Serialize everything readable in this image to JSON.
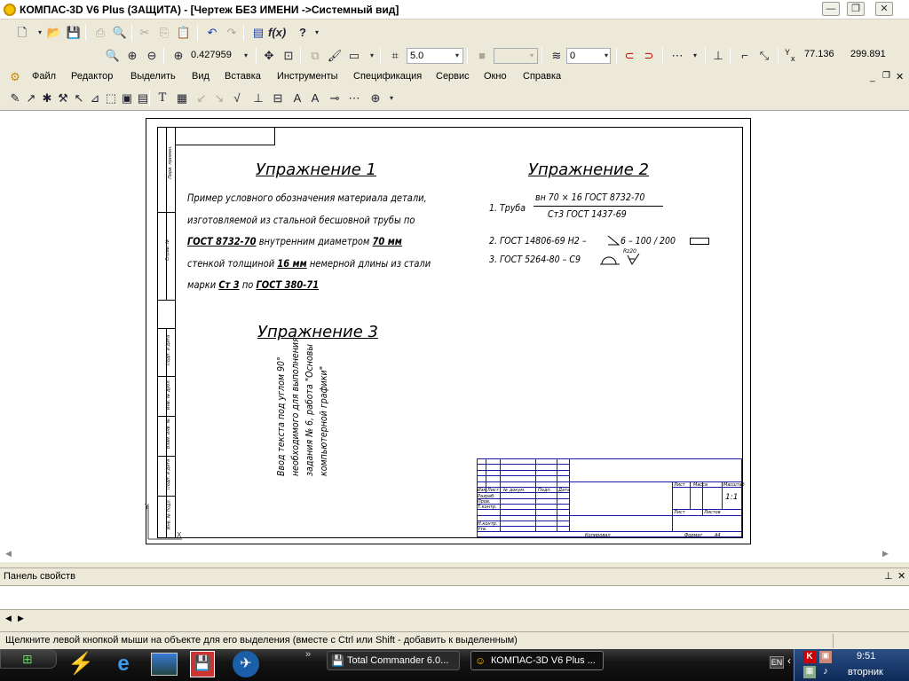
{
  "window": {
    "title": "КОМПАС-3D V6 Plus (ЗАЩИТА) - [Чертеж БЕЗ ИМЕНИ ->Системный вид]"
  },
  "toolbar": {
    "zoom_value": "0.427959",
    "step_value": "5.0",
    "layer_value": "0",
    "coord_x_label": "x",
    "coord_y_label": "Y",
    "coord_x": "77.136",
    "coord_y": "299.891"
  },
  "menu": [
    "Файл",
    "Редактор",
    "Выделить",
    "Вид",
    "Вставка",
    "Инструменты",
    "Спецификация",
    "Сервис",
    "Окно",
    "Справка"
  ],
  "drawing": {
    "ex1_title": "Упражнение 1",
    "ex1_lines": [
      "Пример условного обозначения материала детали,",
      "изготовляемой из стальной бесшовной трубы по",
      "ГОСТ 8732-70 внутренним диаметром 70 мм",
      "стенкой толщиной 16 мм немерной длины из стали",
      "марки Ст 3 по ГОСТ 380-71"
    ],
    "ex1_line3": {
      "a": "ГОСТ 8732-70",
      "b": " внутренним диаметром ",
      "c": "70 мм"
    },
    "ex1_line4": {
      "a": "стенкой толщиной ",
      "b": "16 мм",
      "c": " немерной длины из стали"
    },
    "ex1_line5": {
      "a": "марки ",
      "b": "Ст 3",
      "c": " по ",
      "d": "ГОСТ 380-71"
    },
    "ex2_title": "Упражнение 2",
    "ex2_item1_label": "1. Труба",
    "ex2_item1_num": "вн 70 × 16 ГОСТ 8732-70",
    "ex2_item1_den": "Ст3 ГОСТ 1437-69",
    "ex2_item2": "2. ГОСТ 14806-69 Н2 –",
    "ex2_item2_tail": "6 – 100 / 200",
    "ex2_item3": "3. ГОСТ 5264-80 – С9",
    "ex2_item3_sup": "Rz20",
    "ex3_title": "Упражнение 3",
    "ex3_rot_lines": [
      "Ввод текста под углом 90°",
      "необходимого для выполнения",
      "задания № 6, работа \"Основы",
      "компьютерной графики\""
    ],
    "stamp_sheet": "Лист",
    "stamp_mass": "Масса",
    "stamp_scale": "Масштаб",
    "stamp_scale_val": "1:1",
    "stamp_sheets": "Листов",
    "stamp_sheet2": "Лист",
    "stamp_izm": "Изм",
    "stamp_list": "Лист",
    "stamp_ndoc": "№ докум.",
    "stamp_podp": "Подп.",
    "stamp_data": "Дата",
    "stamp_razrab": "Разраб.",
    "stamp_prov": "Пров.",
    "stamp_tkontr": "Т.контр.",
    "stamp_nkontr": "Н.контр.",
    "stamp_utv": "Утв.",
    "stamp_kopir": "Копировал",
    "stamp_format": "Формат",
    "stamp_format_val": "А4",
    "side_labels": [
      "Перв. примен.",
      "Справ. №",
      "Подп. и дата",
      "Инв. № дубл.",
      "Взам. инв. №",
      "Подп. и дата",
      "Инв. № подл."
    ]
  },
  "panels": {
    "props_title": "Панель свойств"
  },
  "status": {
    "text": "Щелкните левой кнопкой мыши на объекте для его выделения (вместе с Ctrl или Shift - добавить к выделенным)"
  },
  "taskbar": {
    "start": "",
    "task1": "Total Commander 6.0...",
    "task2": "КОМПАС-3D V6 Plus ...",
    "lang": "EN",
    "time": "9:51",
    "day": "вторник"
  },
  "colors": {
    "titlebar_text": "#000000",
    "stamp_lines": "#1a1aa8",
    "taskbar": "#151515"
  }
}
